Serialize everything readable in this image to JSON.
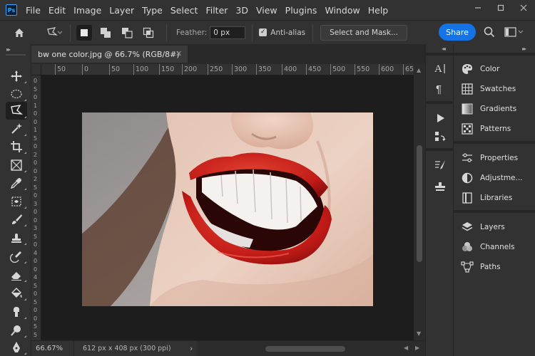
{
  "app": {
    "logo_text": "Ps"
  },
  "menu": [
    "File",
    "Edit",
    "Image",
    "Layer",
    "Type",
    "Select",
    "Filter",
    "3D",
    "View",
    "Plugins",
    "Window",
    "Help"
  ],
  "options_bar": {
    "feather_label": "Feather:",
    "feather_value": "0 px",
    "antialias_label": "Anti-alias",
    "antialias_checked": true,
    "select_mask_label": "Select and Mask...",
    "share_label": "Share"
  },
  "document": {
    "tab_title": "bw one color.jpg @ 66.7% (RGB/8#)",
    "zoom_level": "66.67%",
    "info": "612 px x 408 px (300 ppi)"
  },
  "ruler": {
    "h_labels": [
      "50",
      "0",
      "50",
      "100",
      "150",
      "200",
      "250",
      "300",
      "350",
      "400",
      "450",
      "500",
      "550",
      "600",
      "650"
    ],
    "v_labels": [
      "0",
      "5",
      "0",
      "1",
      "0",
      "0",
      "1",
      "5",
      "0",
      "2",
      "0",
      "0",
      "2",
      "5",
      "0",
      "3",
      "0",
      "0",
      "3",
      "5",
      "0",
      "4",
      "0",
      "0",
      "4",
      "5",
      "0",
      "5",
      "0",
      "0",
      "5",
      "5"
    ]
  },
  "panels": {
    "group1": [
      "Color",
      "Swatches",
      "Gradients",
      "Patterns"
    ],
    "group2": [
      "Properties",
      "Adjustme...",
      "Libraries"
    ],
    "group3": [
      "Layers",
      "Channels",
      "Paths"
    ]
  },
  "tools": [
    "move-tool",
    "marquee-tool",
    "polygonal-lasso-tool",
    "magic-wand-tool",
    "crop-tool",
    "frame-tool",
    "eyedropper-tool",
    "healing-brush-tool",
    "brush-tool",
    "clone-stamp-tool",
    "history-brush-tool",
    "eraser-tool",
    "paint-bucket-tool",
    "smudge-tool",
    "dodge-tool",
    "pen-tool"
  ],
  "colors": {
    "accent": "#1473e6",
    "panel_bg": "#323232",
    "canvas_bg": "#1d1d1d"
  }
}
